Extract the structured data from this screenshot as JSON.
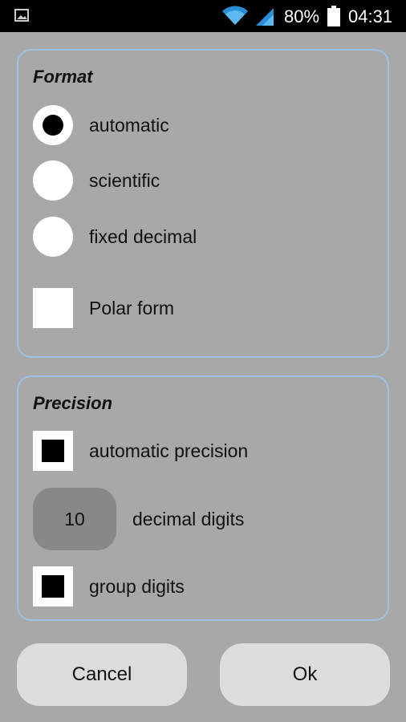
{
  "status_bar": {
    "battery_percent": "80%",
    "time": "04:31",
    "icons": [
      "image-icon",
      "wifi-icon",
      "signal-icon",
      "battery-icon"
    ]
  },
  "format": {
    "title": "Format",
    "options": [
      {
        "label": "automatic",
        "selected": true
      },
      {
        "label": "scientific",
        "selected": false
      },
      {
        "label": "fixed decimal",
        "selected": false
      }
    ],
    "polar_form": {
      "label": "Polar form",
      "checked": false
    }
  },
  "precision": {
    "title": "Precision",
    "automatic_precision": {
      "label": "automatic precision",
      "checked": true
    },
    "decimal_digits": {
      "value": "10",
      "label": "decimal digits"
    },
    "group_digits": {
      "label": "group digits",
      "checked": true
    }
  },
  "buttons": {
    "cancel": "Cancel",
    "ok": "Ok"
  },
  "colors": {
    "background": "#a8a8a8",
    "panel_border": "#9cc0e8",
    "button": "#dcdcdc",
    "input": "#888888"
  }
}
